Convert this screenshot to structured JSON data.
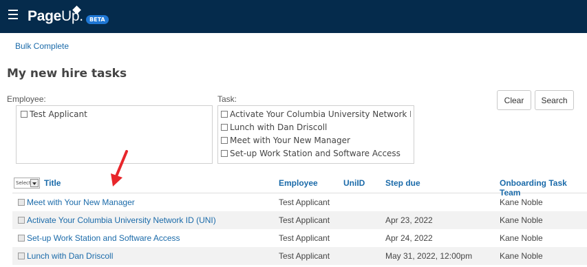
{
  "header": {
    "logo_main": "Page",
    "logo_up": "Up.",
    "beta_badge": "BETA"
  },
  "toolbar": {
    "bulk_complete": "Bulk Complete"
  },
  "page": {
    "title": "My new hire tasks"
  },
  "filters": {
    "employee_label": "Employee:",
    "employees": [
      "Test Applicant"
    ],
    "task_label": "Task:",
    "tasks": [
      "Activate Your Columbia University Network ID (UI",
      "Lunch with Dan Driscoll",
      "Meet with Your New Manager",
      "Set-up Work Station and Software Access"
    ],
    "clear_label": "Clear",
    "search_label": "Search"
  },
  "table": {
    "select_label": "Select",
    "columns": [
      "Title",
      "Employee",
      "UniID",
      "Step due",
      "Onboarding Task Team"
    ],
    "rows": [
      {
        "title": "Meet with Your New Manager",
        "employee": "Test Applicant",
        "uniid": "",
        "step_due": "",
        "team": "Kane Noble"
      },
      {
        "title": "Activate Your Columbia University Network ID (UNI)",
        "employee": "Test Applicant",
        "uniid": "",
        "step_due": "Apr 23, 2022",
        "team": "Kane Noble"
      },
      {
        "title": "Set-up Work Station and Software Access",
        "employee": "Test Applicant",
        "uniid": "",
        "step_due": "Apr 24, 2022",
        "team": "Kane Noble"
      },
      {
        "title": "Lunch with Dan Driscoll",
        "employee": "Test Applicant",
        "uniid": "",
        "step_due": "May 31, 2022, 12:00pm",
        "team": "Kane Noble"
      }
    ]
  },
  "colors": {
    "topbar": "#052b4c",
    "link": "#1a6aa9",
    "beta": "#1f77d4",
    "annotation_arrow": "#e8262b"
  }
}
